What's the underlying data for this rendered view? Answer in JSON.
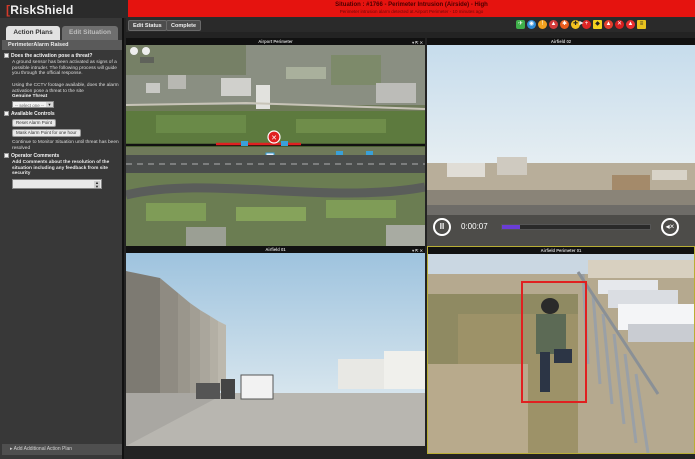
{
  "app": {
    "logo": "RiskShield"
  },
  "alert": {
    "title": "Situation : #1766 - Perimeter Intrusion (Airside) - High",
    "subtitle": "Perimeter intrusion alarm detected at Airport Perimeter - 10 minutes ago"
  },
  "left_panel": {
    "tabs": [
      {
        "label": "Action Plans"
      },
      {
        "label": "Edit Situation"
      }
    ],
    "section_title": "PerimeterAlarm Raised",
    "q1": {
      "label": "Does the activation pose a threat?",
      "text1": "A ground sensor has been activated as signs of a possible intruder. The following process will guide you through the official response.",
      "text2": "Using the CCTV footage available, does the alarm activation pose a threat to the site",
      "field_label": "Genuine Threat",
      "select_value": "-- select one --"
    },
    "q2": {
      "label": "Available Controls",
      "btn_reset": "Reset Alarm Point",
      "btn_mask": "Mask Alarm Point for one hour",
      "text": "Continue to Monitor Situation until threat has been resolved"
    },
    "q3": {
      "label": "Operator Comments",
      "text": "Add Comments about the resolution of the situation including any feedback from site security"
    },
    "add_plan": "▸ Add Additional Action Plan"
  },
  "toolbar": {
    "edit_status": "Edit Status",
    "complete": "Complete",
    "play": "►"
  },
  "panes": [
    {
      "title": "Airport Perimeter"
    },
    {
      "title": "Airfield 02",
      "time": "0:00:07",
      "progress": 0.12
    },
    {
      "title": "Airfield 01"
    },
    {
      "title": "Airfield Perimeter 01"
    }
  ],
  "colors": {
    "alert": "#e5130f",
    "accent": "#d43a2a",
    "highlight": "#b8ae35",
    "detection_box": "#e02020",
    "progress": "#6a3dd6"
  }
}
